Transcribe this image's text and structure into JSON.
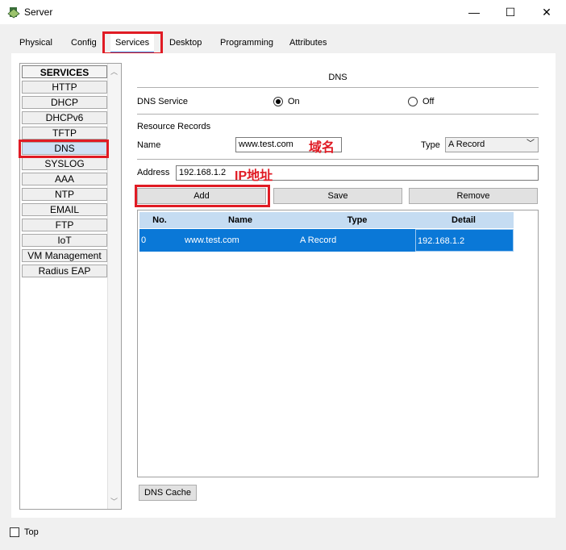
{
  "window": {
    "title": "Server",
    "minimize_glyph": "—",
    "maximize_glyph": "☐",
    "close_glyph": "✕"
  },
  "tabs": [
    "Physical",
    "Config",
    "Services",
    "Desktop",
    "Programming",
    "Attributes"
  ],
  "active_tab": "Services",
  "sidebar": {
    "header": "SERVICES",
    "items": [
      "HTTP",
      "DHCP",
      "DHCPv6",
      "TFTP",
      "DNS",
      "SYSLOG",
      "AAA",
      "NTP",
      "EMAIL",
      "FTP",
      "IoT",
      "VM Management",
      "Radius EAP"
    ],
    "active_item": "DNS"
  },
  "dns": {
    "title": "DNS",
    "service_label": "DNS Service",
    "on_label": "On",
    "off_label": "Off",
    "service_state": "On",
    "records_label": "Resource Records",
    "name_label": "Name",
    "name_value": "www.test.com",
    "type_label": "Type",
    "type_value": "A Record",
    "address_label": "Address",
    "address_value": "192.168.1.2",
    "add_label": "Add",
    "save_label": "Save",
    "remove_label": "Remove",
    "cache_label": "DNS Cache"
  },
  "annotations": {
    "domain_name": "域名",
    "ip_address": "IP地址",
    "color": "#e01b24"
  },
  "table": {
    "columns": [
      "No.",
      "Name",
      "Type",
      "Detail"
    ],
    "rows": [
      {
        "no": "0",
        "name": "www.test.com",
        "type": "A Record",
        "detail": "192.168.1.2"
      }
    ]
  },
  "footer": {
    "top_label": "Top",
    "top_checked": false
  }
}
